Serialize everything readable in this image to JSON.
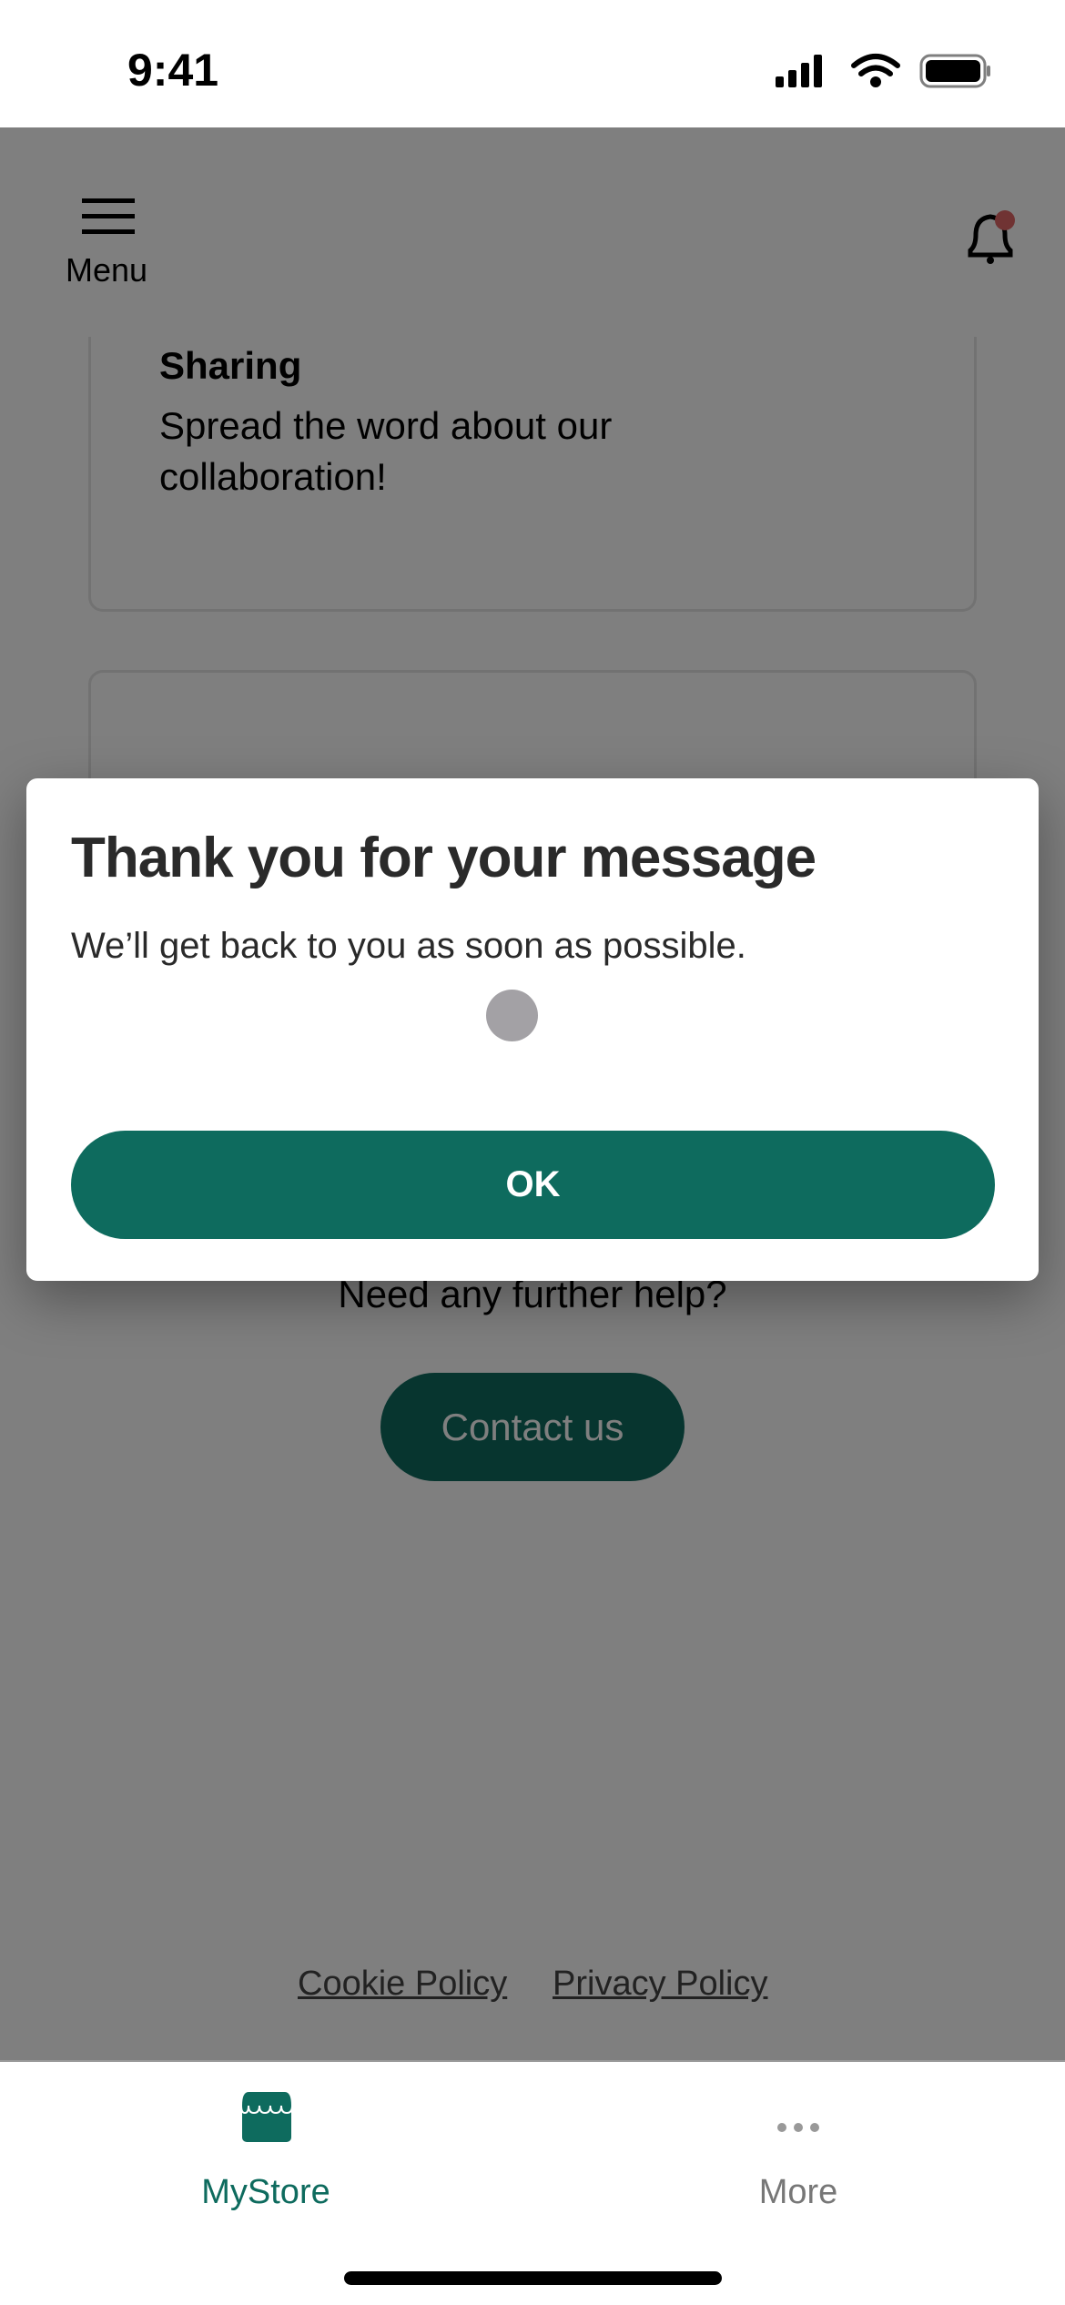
{
  "status_bar": {
    "time": "9:41"
  },
  "header": {
    "menu_label": "Menu",
    "notification_badge_color": "#e06666"
  },
  "cards": [
    {
      "title": "Sharing",
      "description": "Spread the word about our collaboration!"
    }
  ],
  "help": {
    "text": "Need any further help?",
    "contact_label": "Contact us"
  },
  "footer": {
    "links": [
      "Cookie Policy",
      "Privacy Policy"
    ]
  },
  "dialog": {
    "title": "Thank you for your message",
    "message": "We’ll get back to you as soon as possible.",
    "ok_label": "OK"
  },
  "tabbar": {
    "items": [
      {
        "label": "MyStore",
        "icon": "store-icon",
        "active": true
      },
      {
        "label": "More",
        "icon": "more-dots-icon",
        "active": false
      }
    ]
  },
  "colors": {
    "brand": "#0e6b5e",
    "overlay": "#808080"
  }
}
